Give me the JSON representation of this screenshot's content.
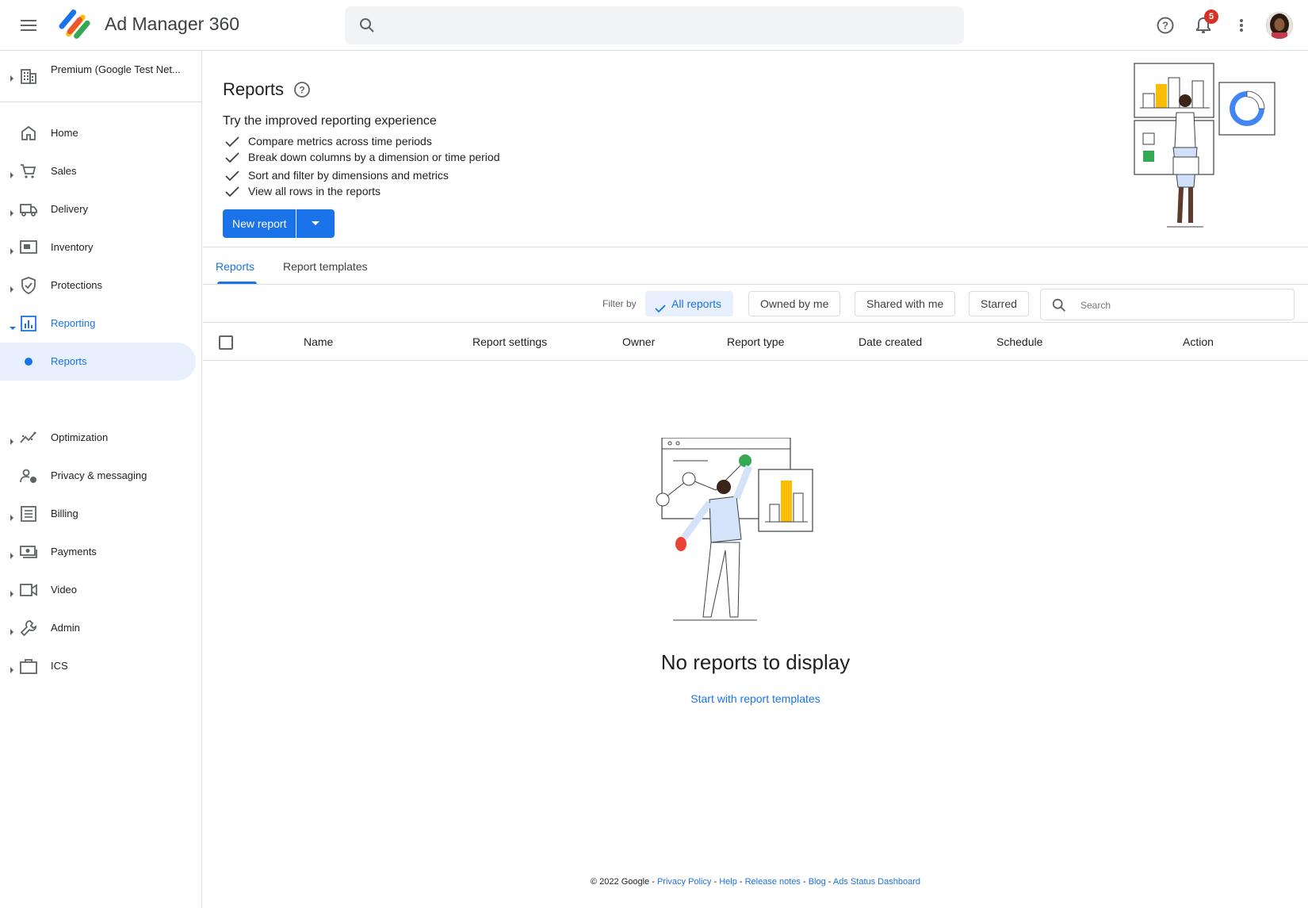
{
  "app": {
    "title": "Ad Manager 360",
    "search_placeholder": ""
  },
  "notifications": {
    "count": "5"
  },
  "sidebar": {
    "network": "Premium (Google Test Net...",
    "items": [
      {
        "label": "Home",
        "icon": "home-icon"
      },
      {
        "label": "Sales",
        "icon": "cart-icon"
      },
      {
        "label": "Delivery",
        "icon": "truck-icon"
      },
      {
        "label": "Inventory",
        "icon": "inventory-icon"
      },
      {
        "label": "Protections",
        "icon": "shield-icon"
      },
      {
        "label": "Reporting",
        "icon": "bar-chart-icon"
      },
      {
        "label": "Reports",
        "icon": "dot-icon"
      },
      {
        "label": "Optimization",
        "icon": "trend-icon"
      },
      {
        "label": "Privacy & messaging",
        "icon": "privacy-icon"
      },
      {
        "label": "Billing",
        "icon": "list-icon"
      },
      {
        "label": "Payments",
        "icon": "payments-icon"
      },
      {
        "label": "Video",
        "icon": "video-icon"
      },
      {
        "label": "Admin",
        "icon": "wrench-icon"
      },
      {
        "label": "ICS",
        "icon": "briefcase-icon"
      }
    ]
  },
  "page": {
    "title": "Reports",
    "promo_heading": "Try the improved reporting experience",
    "features": [
      "Compare metrics across time periods",
      "Break down columns by a dimension or time period",
      "Sort and filter by dimensions and metrics",
      "View all rows in the reports"
    ],
    "new_report_label": "New report"
  },
  "tabs": [
    "Reports",
    "Report templates"
  ],
  "filters": {
    "label": "Filter by",
    "chips": [
      "All reports",
      "Owned by me",
      "Shared with me",
      "Starred"
    ],
    "search_placeholder": "Search"
  },
  "table": {
    "columns": [
      "Name",
      "Report settings",
      "Owner",
      "Report type",
      "Date created",
      "Schedule",
      "Action"
    ]
  },
  "empty": {
    "title": "No reports to display",
    "link": "Start with report templates"
  },
  "footer": {
    "copyright": "© 2022 Google",
    "links": [
      "Privacy Policy",
      "Help",
      "Release notes",
      "Blog",
      "Ads Status Dashboard"
    ]
  },
  "colors": {
    "accent": "#1a73e8",
    "badge": "#d93025",
    "selected_bg": "#e8f0fe"
  }
}
